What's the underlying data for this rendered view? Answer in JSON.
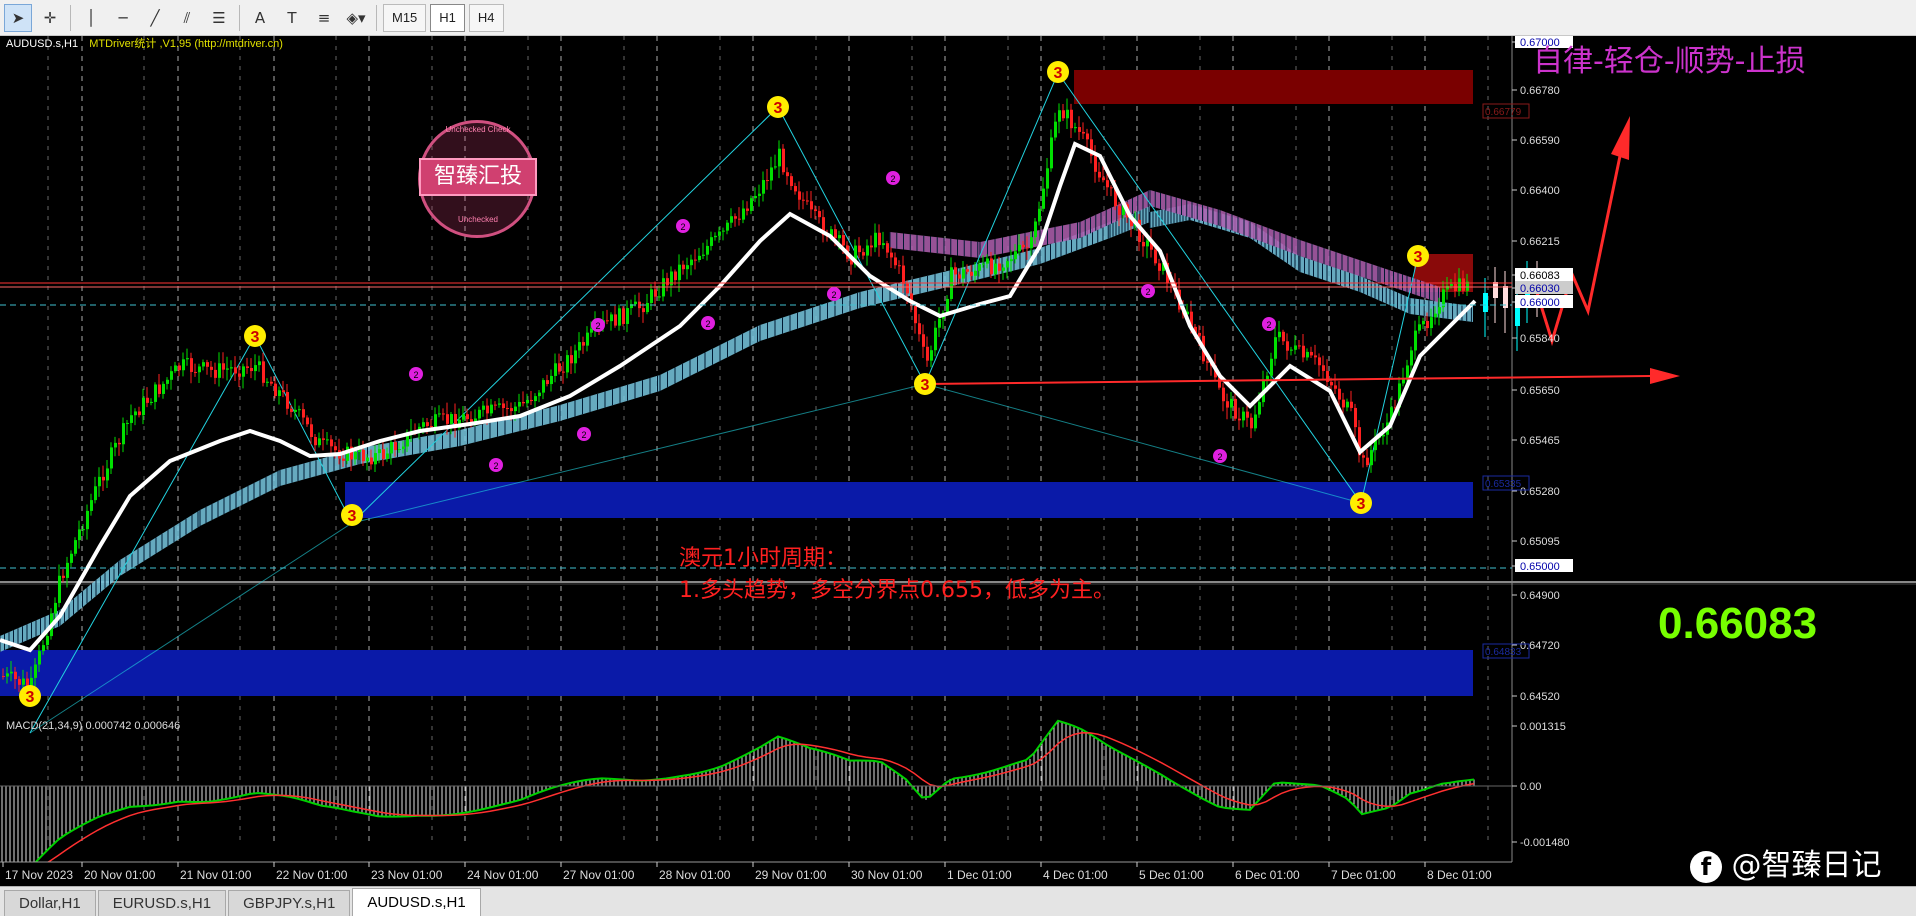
{
  "toolbar": {
    "tools": [
      {
        "name": "cursor-icon",
        "glyph": "➤"
      },
      {
        "name": "crosshair-icon",
        "glyph": "✛"
      },
      {
        "name": "vertical-line-icon",
        "glyph": "│"
      },
      {
        "name": "horizontal-line-icon",
        "glyph": "─"
      },
      {
        "name": "trendline-icon",
        "glyph": "╱"
      },
      {
        "name": "equidistant-channel-icon",
        "glyph": "⫽"
      },
      {
        "name": "fibonacci-icon",
        "glyph": "☰"
      },
      {
        "name": "text-icon",
        "glyph": "A"
      },
      {
        "name": "text-label-icon",
        "glyph": "T"
      },
      {
        "name": "fibo-fan-icon",
        "glyph": "≡"
      },
      {
        "name": "shapes-dropdown-icon",
        "glyph": "◈▾"
      }
    ],
    "timeframes": [
      "M15",
      "H1",
      "H4"
    ],
    "active_timeframe": "H1"
  },
  "chart": {
    "symbol_header": "AUDUSD.s,H1",
    "indicator_header": "MTDriver统计 ,V1.95 (http://mtdriver.cn)",
    "slogan": "自律-轻仓-顺势-止损",
    "big_price": "0.66083",
    "analysis_title": "澳元1小时周期：",
    "analysis_line": "1.多头趋势，多空分界点0.655，低多为主。",
    "watermark_cn": "智臻汇投",
    "watermark_ring_top": "Unchecked  Check",
    "watermark_ring_bottom": "Unchecked",
    "macd_label": "MACD(21,34,9) 0.000742 0.000646",
    "brand_mark": "@智臻日记",
    "price_axis": [
      "0.67000",
      "0.66780",
      "0.66590",
      "0.66400",
      "0.66215",
      "0.66083",
      "0.66030",
      "0.66000",
      "0.65840",
      "0.65650",
      "0.65465",
      "0.65280",
      "0.65095",
      "0.65000",
      "0.64900",
      "0.64720",
      "0.64520"
    ],
    "macd_axis": [
      "0.001315",
      "0.00",
      "-0.001480"
    ],
    "zone_labels": [
      "0.66779",
      "0.65335",
      "0.64833"
    ],
    "time_axis": [
      "17 Nov 2023",
      "20 Nov 01:00",
      "21 Nov 01:00",
      "22 Nov 01:00",
      "23 Nov 01:00",
      "24 Nov 01:00",
      "27 Nov 01:00",
      "28 Nov 01:00",
      "29 Nov 01:00",
      "30 Nov 01:00",
      "1 Dec 01:00",
      "4 Dec 01:00",
      "5 Dec 01:00",
      "6 Dec 01:00",
      "7 Dec 01:00",
      "8 Dec 01:00"
    ],
    "wave_labels": {
      "major": "3",
      "minor": "2"
    },
    "colors": {
      "background": "#000000",
      "bull": "#00e000",
      "bear": "#ff2020",
      "ma": "#ffffff",
      "resistance_zone": "#7a0000",
      "support_zone": "#0a1aa8",
      "zigzag": "#22d3e0",
      "arrow": "#ff2a2a",
      "slogan": "#cc33cc",
      "big_price": "#77ff00",
      "wave_major": "#ffee00",
      "wave_minor": "#e020e0",
      "macd_signal": "#ff3030",
      "macd_line": "#00d000"
    }
  },
  "tabs": [
    "Dollar,H1",
    "EURUSD.s,H1",
    "GBPJPY.s,H1",
    "AUDUSD.s,H1"
  ],
  "active_tab": "AUDUSD.s,H1"
}
